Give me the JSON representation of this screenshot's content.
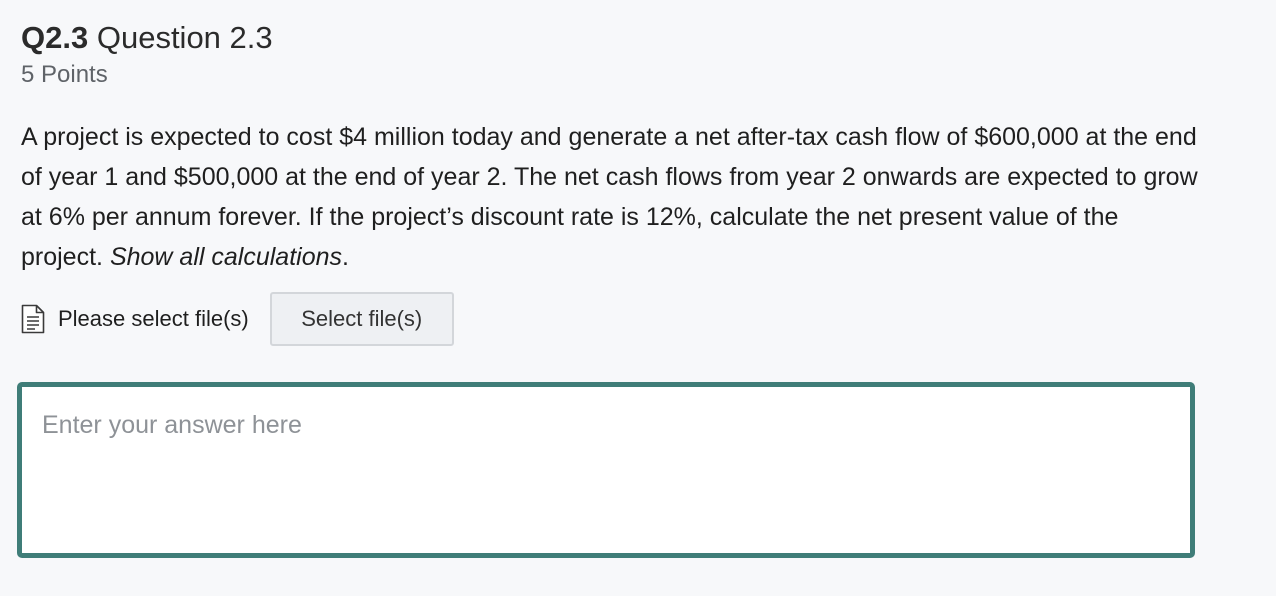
{
  "question": {
    "number": "Q2.3",
    "title": "Question 2.3",
    "points": "5 Points",
    "body_text": "A project is expected to cost $4 million today and generate a net after-tax cash flow of $600,000 at the end of year 1 and $500,000 at the end of year 2. The net cash flows from year 2 onwards are expected to grow at 6% per annum forever. If the project’s discount rate is 12%, calculate the net present value of the project. ",
    "body_emphasis": "Show all calculations",
    "body_end": "."
  },
  "file_upload": {
    "icon": "document-icon",
    "label": "Please select file(s)",
    "button_label": "Select file(s)"
  },
  "answer": {
    "value": "",
    "placeholder": "Enter your answer here"
  },
  "colors": {
    "background": "#f7f8fa",
    "answer_border": "#3f7d78",
    "button_background": "#eef0f3",
    "button_border": "#d3d6da"
  }
}
